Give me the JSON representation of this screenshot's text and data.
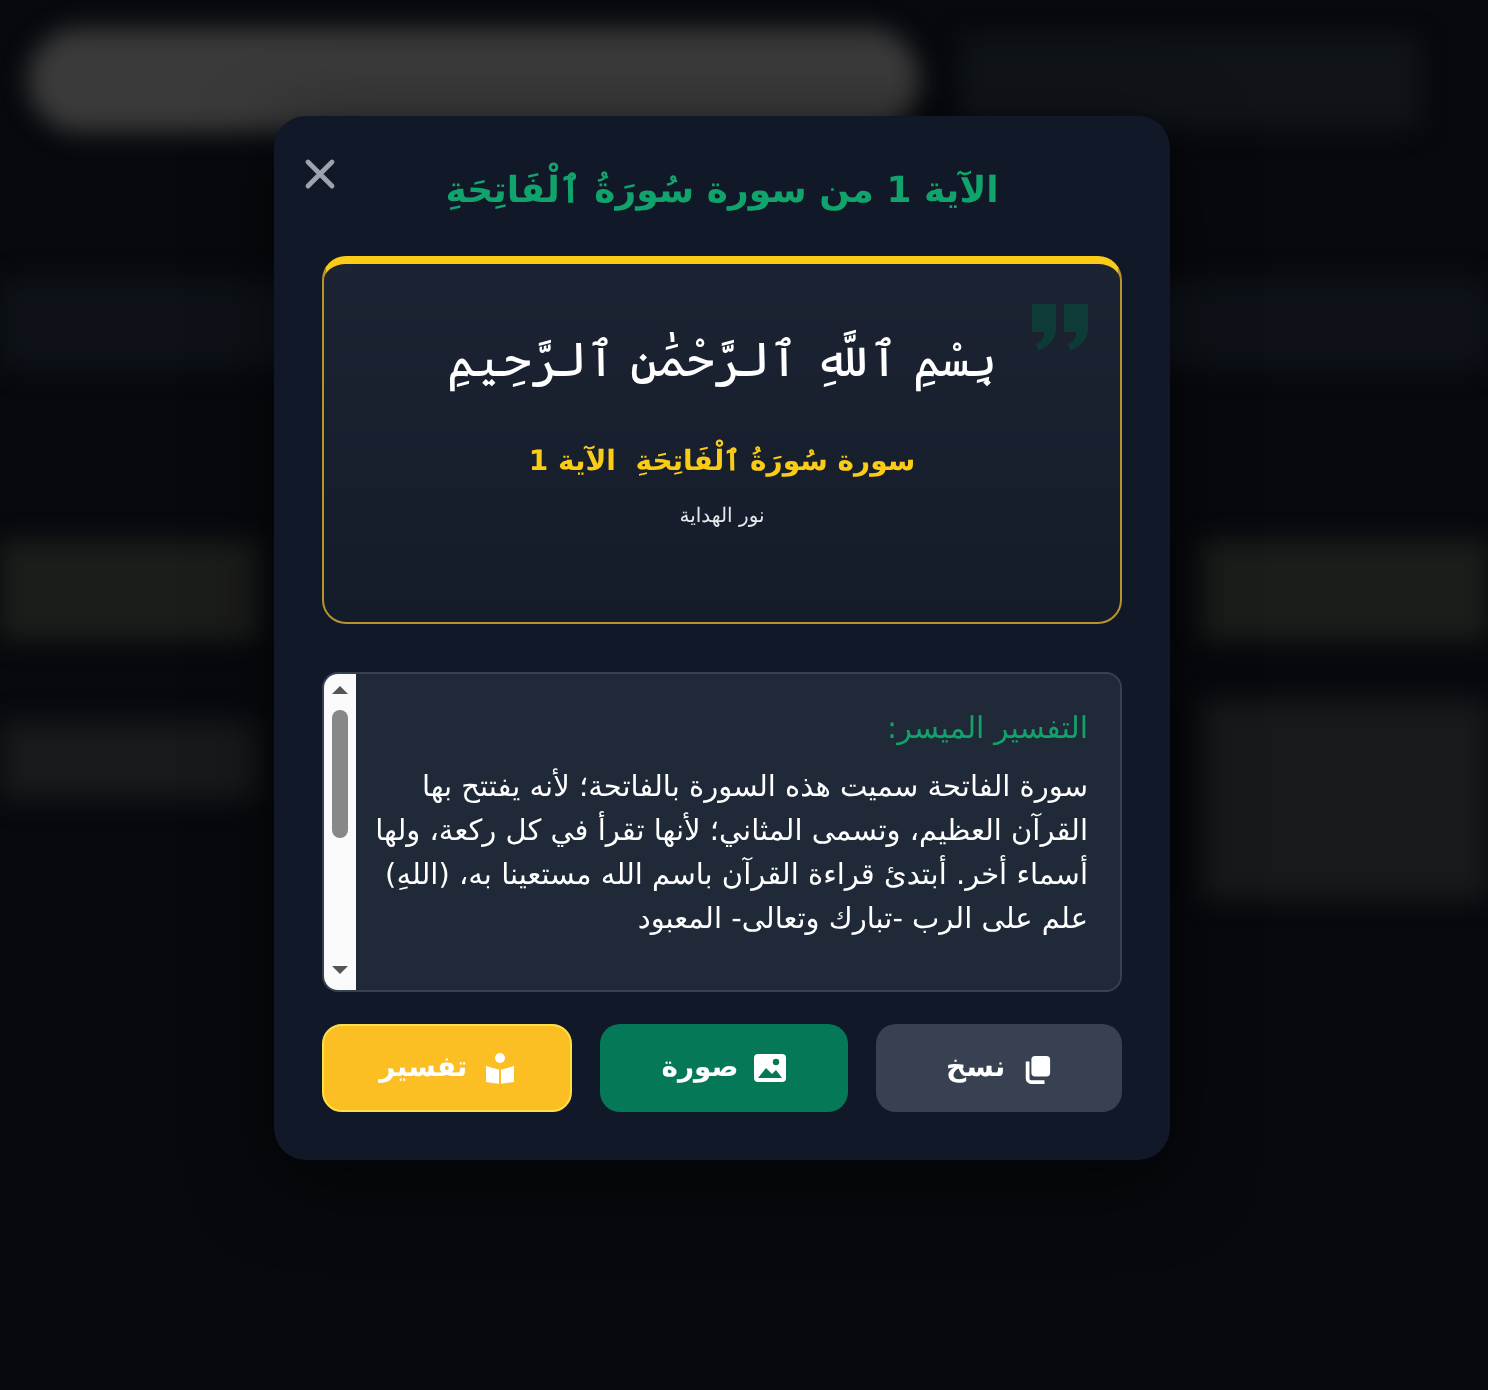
{
  "dialog": {
    "title": "الآية 1 من سورة سُورَةُ ٱلْفَاتِحَةِ",
    "verse_card": {
      "verse": "بِسْمِ ٱللَّهِ ٱلرَّحْمَٰنِ ٱلرَّحِيمِ",
      "reference": "سورة سُورَةُ ٱلْفَاتِحَةِ  الآية 1",
      "source": "نور الهداية"
    },
    "tafsir": {
      "heading": "التفسير الميسر:",
      "text": "سورة الفاتحة سميت هذه السورة بالفاتحة؛ لأنه يفتتح بها القرآن العظيم، وتسمى المثاني؛ لأنها تقرأ في كل ركعة، ولها أسماء أخر. أبتدئ قراءة القرآن باسم الله مستعينا به، (اللهِ) علم على الرب -تبارك وتعالى- المعبود"
    },
    "buttons": [
      {
        "label": "نسخ",
        "kind": "copy"
      },
      {
        "label": "صورة",
        "kind": "image"
      },
      {
        "label": "تفسير",
        "kind": "tafsir"
      }
    ]
  }
}
